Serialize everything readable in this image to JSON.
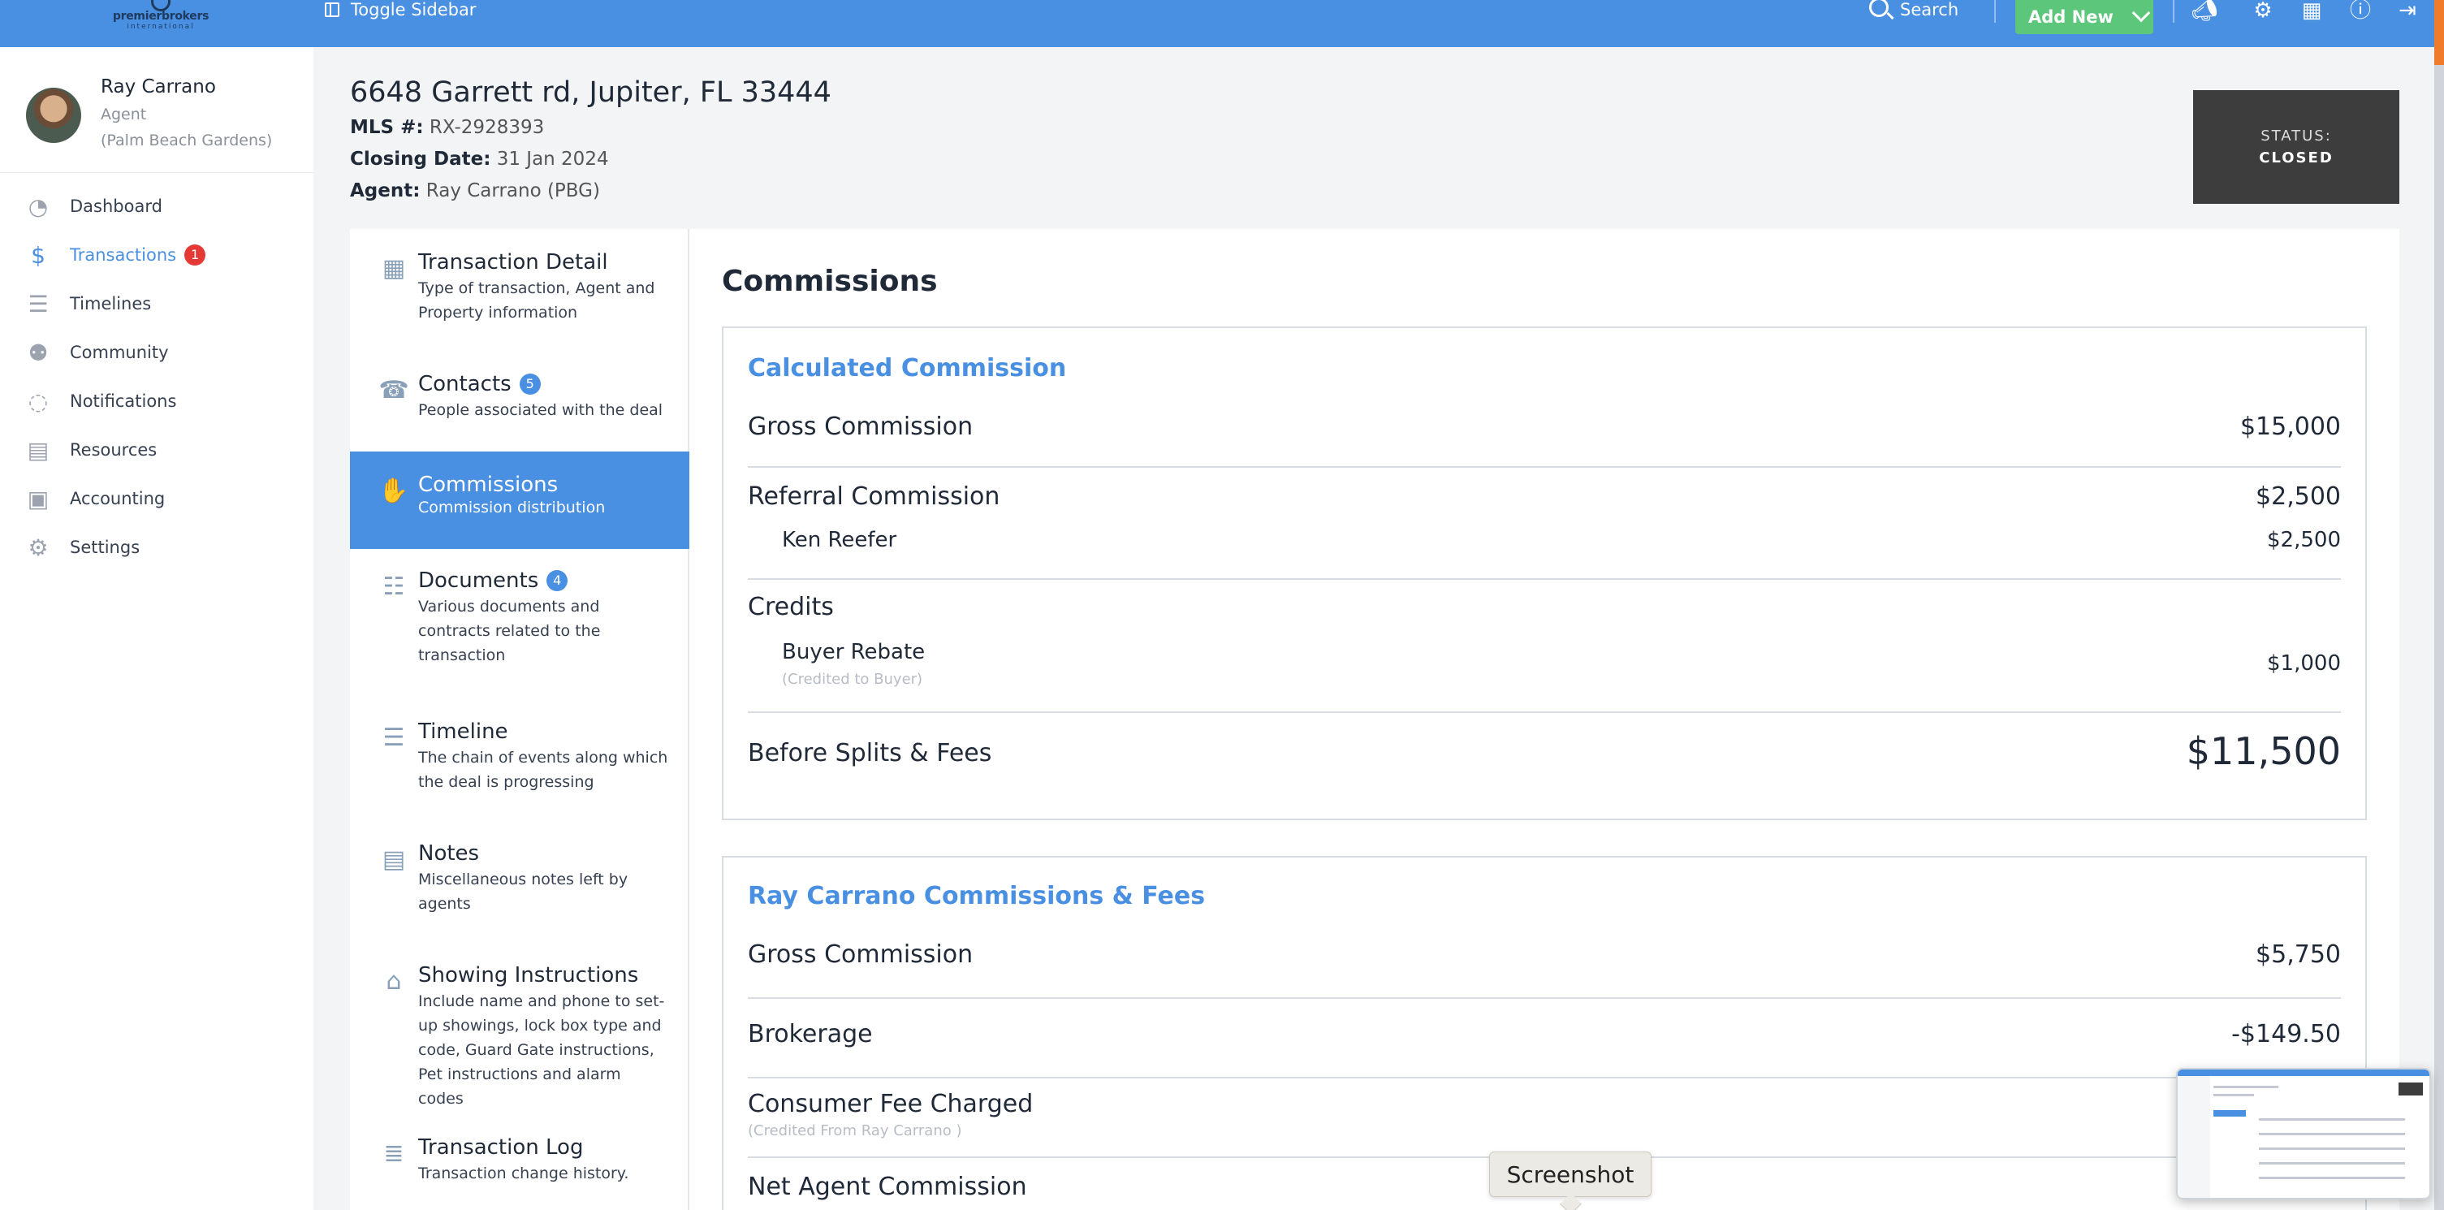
{
  "brand": {
    "name": "premierbrokers",
    "sub": "international"
  },
  "topbar": {
    "toggle_label": "Toggle Sidebar",
    "search_label": "Search",
    "add_new_label": "Add New"
  },
  "user": {
    "name": "Ray Carrano",
    "role": "Agent",
    "office": "(Palm Beach Gardens)"
  },
  "sidebar": {
    "items": [
      {
        "label": "Dashboard",
        "icon": "gauge-icon"
      },
      {
        "label": "Transactions",
        "icon": "dollar-cycle-icon",
        "badge": "1",
        "active": true
      },
      {
        "label": "Timelines",
        "icon": "timeline-icon"
      },
      {
        "label": "Community",
        "icon": "community-icon"
      },
      {
        "label": "Notifications",
        "icon": "chat-bubble-icon"
      },
      {
        "label": "Resources",
        "icon": "folder-icon"
      },
      {
        "label": "Accounting",
        "icon": "calculator-icon"
      },
      {
        "label": "Settings",
        "icon": "gear-icon"
      }
    ]
  },
  "property": {
    "address": "6648 Garrett rd, Jupiter, FL 33444",
    "mls_label": "MLS #:",
    "mls_value": "RX-2928393",
    "closing_label": "Closing Date:",
    "closing_value": "31 Jan 2024",
    "agent_label": "Agent:",
    "agent_value": "Ray Carrano (PBG)"
  },
  "status": {
    "label": "STATUS:",
    "value": "CLOSED"
  },
  "sections": [
    {
      "title": "Transaction Detail",
      "desc": "Type of transaction, Agent and Property information",
      "icon": "building-icon"
    },
    {
      "title": "Contacts",
      "badge": "5",
      "desc": "People associated with the deal",
      "icon": "phone-book-icon"
    },
    {
      "title": "Commissions",
      "desc": "Commission distribution",
      "icon": "money-hand-icon",
      "active": true
    },
    {
      "title": "Documents",
      "badge": "4",
      "desc": "Various documents and contracts related to the transaction",
      "icon": "document-icon"
    },
    {
      "title": "Timeline",
      "desc": "The chain of events along which the deal is progressing",
      "icon": "timeline-list-icon"
    },
    {
      "title": "Notes",
      "desc": "Miscellaneous notes left by agents",
      "icon": "note-icon"
    },
    {
      "title": "Showing Instructions",
      "desc": "Include name and phone to set-up showings, lock box type and code, Guard Gate instructions, Pet instructions and alarm codes",
      "icon": "house-icon"
    },
    {
      "title": "Transaction Log",
      "desc": "Transaction change history.",
      "icon": "log-icon"
    }
  ],
  "commissions": {
    "title": "Commissions",
    "calculated": {
      "title": "Calculated Commission",
      "gross_label": "Gross Commission",
      "gross_value": "$15,000",
      "referral_label": "Referral Commission",
      "referral_value": "$2,500",
      "referral_sub_label": "Ken Reefer",
      "referral_sub_value": "$2,500",
      "credits_label": "Credits",
      "rebate_label": "Buyer Rebate",
      "rebate_note": "(Credited to Buyer)",
      "rebate_value": "$1,000",
      "before_label": "Before Splits & Fees",
      "before_value": "$11,500"
    },
    "agent": {
      "title": "Ray Carrano Commissions & Fees",
      "gross_label": "Gross Commission",
      "gross_value": "$5,750",
      "brokerage_label": "Brokerage",
      "brokerage_value": "-$149.50",
      "consumer_label": "Consumer Fee Charged",
      "consumer_note": "(Credited From Ray Carrano )",
      "net_label": "Net Agent Commission"
    }
  },
  "overlay": {
    "tooltip": "Screenshot"
  }
}
